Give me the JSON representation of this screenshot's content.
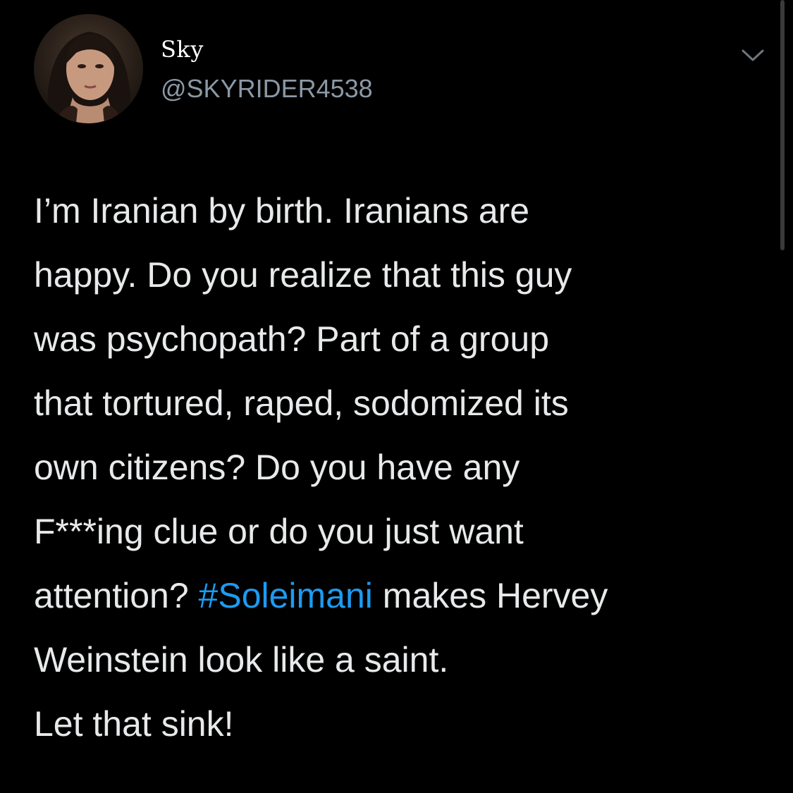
{
  "tweet": {
    "author": {
      "display_name": "Sky",
      "handle": "@SKYRIDER4538"
    },
    "menu_icon": "chevron-down-icon",
    "text": {
      "line1": "I’m Iranian by birth. Iranians are",
      "line2": "happy. Do you realize that this guy",
      "line3": "was psychopath? Part of a group",
      "line4": "that tortured, raped, sodomized its",
      "line5": "own citizens? Do you have any",
      "line6": "F***ing clue or do you just want",
      "line7_before": "attention? ",
      "hashtag": "#Soleimani",
      "line7_after": " makes Hervey",
      "line8": "Weinstein look like a saint.",
      "line9": "Let that sink!"
    }
  },
  "colors": {
    "background": "#000000",
    "text": "#e7e9ea",
    "secondary_text": "#8b98a5",
    "link": "#1d9bf0"
  }
}
